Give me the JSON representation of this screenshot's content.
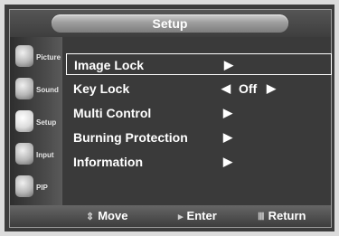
{
  "header": {
    "title": "Setup"
  },
  "sidebar": {
    "items": [
      {
        "label": "Picture",
        "icon": "picture-icon"
      },
      {
        "label": "Sound",
        "icon": "sound-icon"
      },
      {
        "label": "Setup",
        "icon": "setup-icon"
      },
      {
        "label": "Input",
        "icon": "input-icon"
      },
      {
        "label": "PIP",
        "icon": "pip-icon"
      }
    ]
  },
  "menu": {
    "items": [
      {
        "label": "Image Lock",
        "arrow": "▶"
      },
      {
        "label": "Key Lock",
        "left_arrow": "◀",
        "value": "Off",
        "right_arrow": "▶"
      },
      {
        "label": "Multi Control",
        "arrow": "▶"
      },
      {
        "label": "Burning Protection",
        "arrow": "▶"
      },
      {
        "label": "Information",
        "arrow": "▶"
      }
    ]
  },
  "footer": {
    "move": {
      "label": "Move",
      "icon": "⇕"
    },
    "enter": {
      "label": "Enter",
      "icon": "▸"
    },
    "return": {
      "label": "Return",
      "icon": "Ⅲ"
    }
  }
}
